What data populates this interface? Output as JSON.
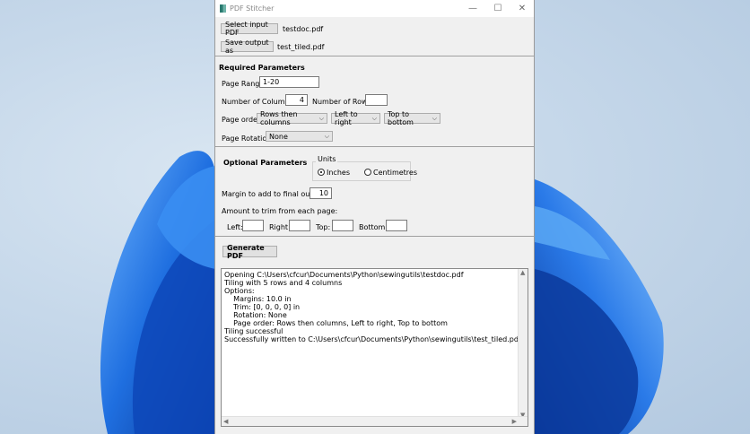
{
  "window": {
    "title": "PDF Stitcher",
    "controls": {
      "minimize": "—",
      "maximize": "☐",
      "close": "✕"
    }
  },
  "files": {
    "select_input_label": "Select input PDF",
    "input_filename": "testdoc.pdf",
    "save_output_label": "Save output as",
    "output_filename": "test_tiled.pdf"
  },
  "required": {
    "heading": "Required Parameters",
    "page_range_label": "Page Range:",
    "page_range_value": "1-20",
    "columns_label": "Number of Columns:",
    "columns_value": "4",
    "rows_label": "Number of Rows:",
    "rows_value": "",
    "page_order_label": "Page order:",
    "page_order_value": "Rows then columns",
    "direction_value": "Left to right",
    "vertical_value": "Top to bottom",
    "rotation_label": "Page Rotation:",
    "rotation_value": "None"
  },
  "optional": {
    "heading": "Optional Parameters",
    "units_label": "Units",
    "units_options": [
      "Inches",
      "Centimetres"
    ],
    "units_selected": "Inches",
    "margin_label": "Margin to add to final output:",
    "margin_value": "10",
    "trim_label": "Amount to trim from each page:",
    "left_label": "Left:",
    "right_label": "Right:",
    "top_label": "Top:",
    "bottom_label": "Bottom:",
    "left_value": "",
    "right_value": "",
    "top_value": "",
    "bottom_value": ""
  },
  "actions": {
    "generate_label": "Generate PDF"
  },
  "log": {
    "lines": [
      "Opening C:\\Users\\cfcur\\Documents\\Python\\sewingutils\\testdoc.pdf",
      "Tiling with 5 rows and 4 columns",
      "Options:",
      "    Margins: 10.0 in",
      "    Trim: [0, 0, 0, 0] in",
      "    Rotation: None",
      "    Page order: Rows then columns, Left to right, Top to bottom",
      "Tiling successful",
      "Successfully written to C:\\Users\\cfcur\\Documents\\Python\\sewingutils\\test_tiled.pdf"
    ]
  },
  "colors": {
    "bloom_dark": "#0a3fa8",
    "bloom_mid": "#1f6fe0",
    "bloom_light": "#5ba8f5"
  }
}
